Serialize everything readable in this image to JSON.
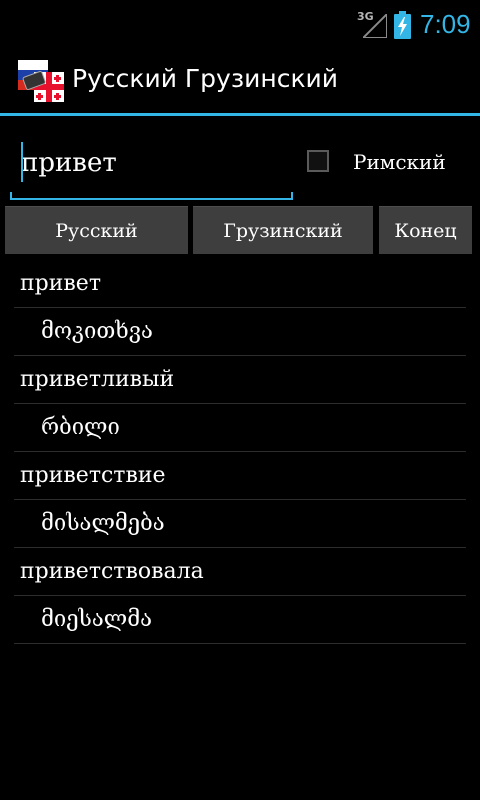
{
  "status_bar": {
    "network": "3G",
    "time": "7:09",
    "accent_color": "#33b5e5"
  },
  "app": {
    "title": "Русский Грузинский",
    "icon": "flag-icon"
  },
  "search": {
    "value": "привет",
    "checkbox_label": "Римский",
    "checkbox_checked": false
  },
  "buttons": {
    "russian": "Русский",
    "georgian": "Грузинский",
    "end": "Конец"
  },
  "results": [
    {
      "word": "привет",
      "translation": "მოკითხვა"
    },
    {
      "word": "приветливый",
      "translation": "რბილი"
    },
    {
      "word": "приветствие",
      "translation": "მისალმება"
    },
    {
      "word": "приветствовала",
      "translation": "მიესალმა"
    }
  ]
}
